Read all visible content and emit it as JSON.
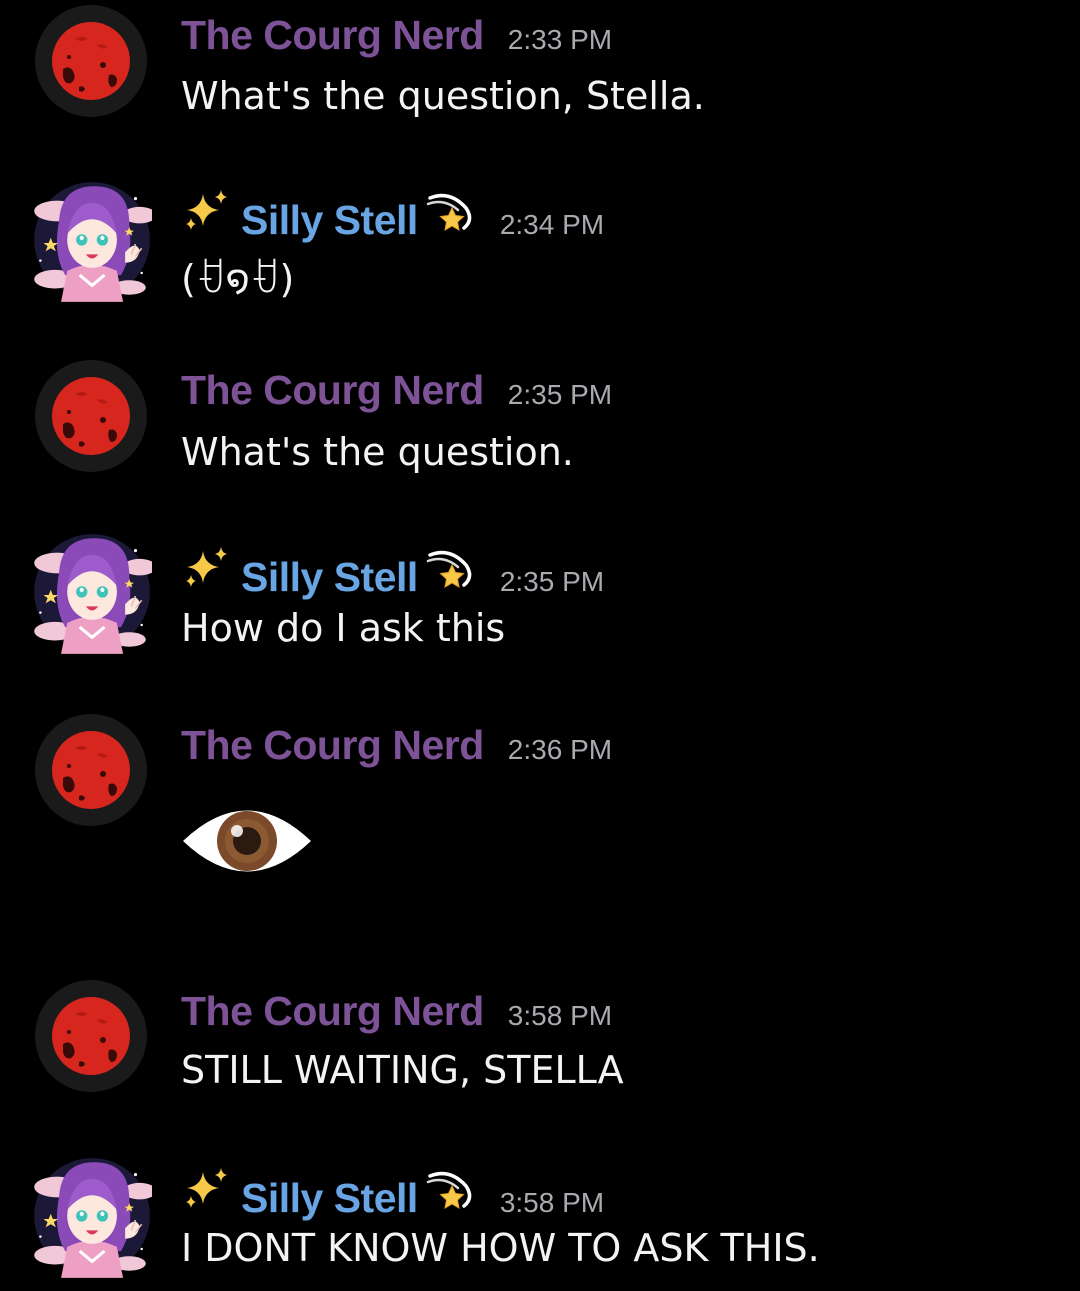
{
  "messages": [
    {
      "author": "The Courg Nerd",
      "time": "2:33 PM",
      "text": "What's the question, Stella."
    },
    {
      "author": "Silly Stell",
      "time": "2:34 PM",
      "text": "(ꀀ໑ꀀ)"
    },
    {
      "author": "The Courg Nerd",
      "time": "2:35 PM",
      "text": "What's the question."
    },
    {
      "author": "Silly Stell",
      "time": "2:35 PM",
      "text": "How do I ask this"
    },
    {
      "author": "The Courg Nerd",
      "time": "2:36 PM",
      "emoji": "eye-emoji"
    },
    {
      "author": "The Courg Nerd",
      "time": "3:58 PM",
      "text": "STILL WAITING, STELLA"
    },
    {
      "author": "Silly Stell",
      "time": "3:58 PM",
      "text": "I DONT KNOW HOW TO ASK THIS."
    }
  ],
  "colors": {
    "background": "#000000",
    "nerd_name": "#7d5296",
    "stell_name": "#69a4e3",
    "timestamp": "#a9a9b0",
    "message_text": "#f2f3f5"
  },
  "icons": {
    "nerd_avatar": "red-moon-avatar",
    "stell_avatar": "anime-girl-avatar",
    "name_prefix": "sparkles-icon",
    "name_suffix": "dizzy-star-icon"
  }
}
